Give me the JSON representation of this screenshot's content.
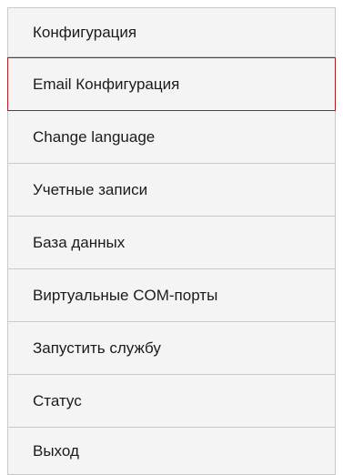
{
  "menu": {
    "selected_border_color": "#b01b1b",
    "items": [
      {
        "label": "Конфигурация"
      },
      {
        "label": "Email Конфигурация"
      },
      {
        "label": "Change language"
      },
      {
        "label": "Учетные записи"
      },
      {
        "label": "База данных"
      },
      {
        "label": "Виртуальные COM-порты"
      },
      {
        "label": "Запустить службу"
      },
      {
        "label": "Статус"
      },
      {
        "label": "Выход"
      }
    ]
  }
}
